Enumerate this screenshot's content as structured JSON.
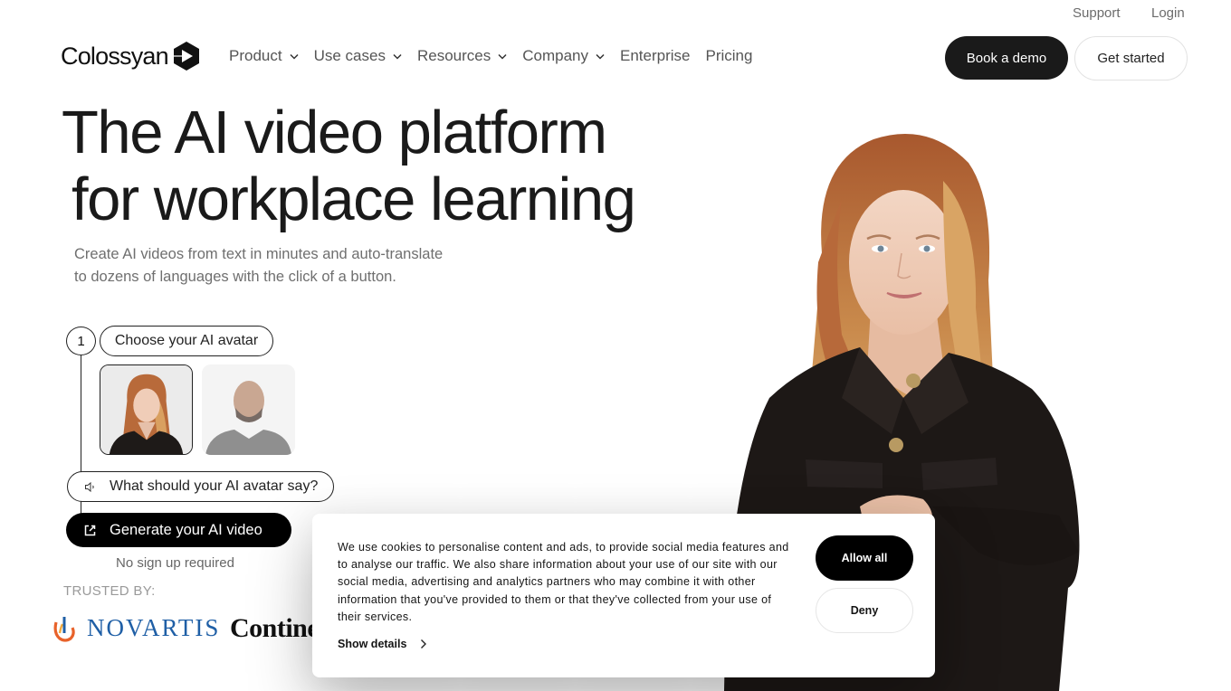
{
  "topbar": {
    "support": "Support",
    "login": "Login"
  },
  "brand": {
    "name": "Colossyan",
    "mark_icon": "play-hexagon-icon"
  },
  "nav": {
    "items": [
      {
        "label": "Product",
        "has_dropdown": true
      },
      {
        "label": "Use cases",
        "has_dropdown": true
      },
      {
        "label": "Resources",
        "has_dropdown": true
      },
      {
        "label": "Company",
        "has_dropdown": true
      },
      {
        "label": "Enterprise",
        "has_dropdown": false
      },
      {
        "label": "Pricing",
        "has_dropdown": false
      }
    ],
    "book_demo": "Book a demo",
    "get_started": "Get started"
  },
  "hero": {
    "title_line1": "The AI video platform",
    "title_line2": "for workplace learning",
    "subtitle_line1": "Create AI videos from text in minutes and auto-translate",
    "subtitle_line2": "to dozens of languages with the click of a button."
  },
  "builder": {
    "step_number": "1",
    "choose_label": "Choose your AI avatar",
    "avatars": [
      {
        "name": "female-avatar",
        "selected": true
      },
      {
        "name": "male-avatar",
        "selected": false
      }
    ],
    "say_label": "What should your AI avatar say?",
    "generate_label": "Generate your AI video",
    "note": "No sign up required"
  },
  "trusted": {
    "label": "TRUSTED BY:",
    "logos": [
      "NOVARTIS",
      "Continental"
    ],
    "novartis_text": "NOVARTIS",
    "conti_text": "Continer"
  },
  "cookie": {
    "text": "We use cookies to personalise content and ads, to provide social media features and to analyse our traffic. We also share information about your use of our site with our social media, advertising and analytics partners who may combine it with other information that you've provided to them or that they've collected from your use of their services.",
    "show_details": "Show details",
    "allow_all": "Allow all",
    "deny": "Deny"
  },
  "colors": {
    "primary_dark": "#1a1a1a",
    "nav_text": "#555555",
    "novartis_blue": "#1f5fa6",
    "novartis_flame_orange": "#e8622a"
  }
}
